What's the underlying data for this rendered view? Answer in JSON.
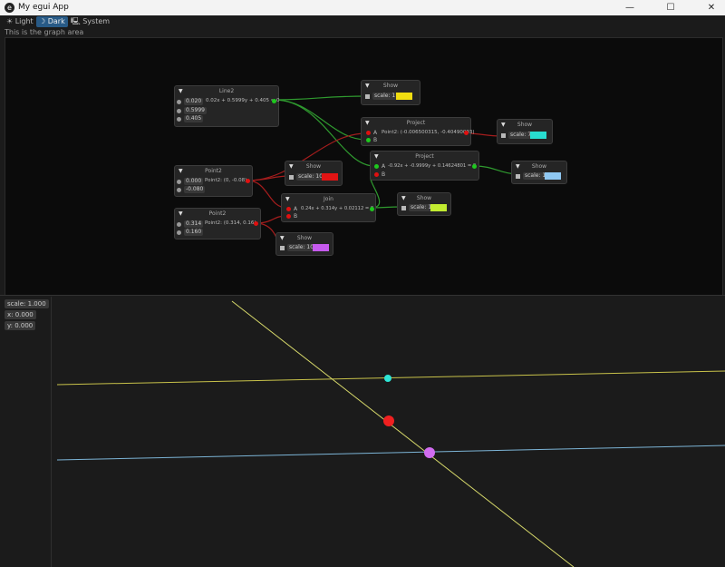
{
  "window": {
    "title": "My egui App",
    "minimize": "—",
    "maximize": "☐",
    "close": "✕"
  },
  "theme": {
    "light": {
      "icon": "☀",
      "label": "Light"
    },
    "dark": {
      "icon": "☽",
      "label": "Dark"
    },
    "system": {
      "icon": "🖳",
      "label": "System"
    }
  },
  "graph_label": "This is the graph area",
  "nodes": {
    "line2": {
      "title": "Line2",
      "v1": "0.020",
      "v2": "0.5999",
      "v3": "0.405",
      "out": "0.02x + 0.5999y + 0.405 = 0"
    },
    "show_yellow": {
      "title": "Show",
      "scale": "scale: 1",
      "color": "#f0dd10"
    },
    "project1": {
      "title": "Project",
      "a": "A",
      "b": "B",
      "out": "Point2: (-0.006500315, -0.40490093)"
    },
    "show_cyan": {
      "title": "Show",
      "scale": "scale: 7",
      "color": "#28ddd0"
    },
    "point2a": {
      "title": "Point2",
      "v1": "0.000",
      "v2": "-0.080",
      "out": "Point2: (0, -0.08)"
    },
    "show_red": {
      "title": "Show",
      "scale": "scale: 10",
      "color": "#e21414"
    },
    "project2": {
      "title": "Project",
      "a": "A",
      "b": "B",
      "out": "-0.92x + -0.9999y + 0.14624801 = 0"
    },
    "show_blue": {
      "title": "Show",
      "scale": "scale: 1",
      "color": "#8fc8f2"
    },
    "join": {
      "title": "Join",
      "a": "A",
      "b": "B",
      "out": "0.24x + 0.314y + 0.02112 = 0"
    },
    "show_lime": {
      "title": "Show",
      "scale": "scale: 1",
      "color": "#c2ec30"
    },
    "point2b": {
      "title": "Point2",
      "v1": "0.314",
      "v2": "0.160",
      "out": "Point2: (0.314, 0.16)"
    },
    "show_violet": {
      "title": "Show",
      "scale": "scale: 10",
      "color": "#c65aee"
    }
  },
  "readout": {
    "scale": "scale: 1.000",
    "x": "x: 0.000",
    "y": "y: 0.000"
  },
  "colors": {
    "accent": "#285a86",
    "wire_green": "#2f9a2f",
    "wire_red": "#a51d1d",
    "plot_yellow": "#c8c24a",
    "plot_blue": "#7cb4d6",
    "plot_diag": "#d6d86a",
    "point_cyan": "#2ee6d6",
    "point_red": "#f02020",
    "point_violet": "#d16cf0"
  }
}
